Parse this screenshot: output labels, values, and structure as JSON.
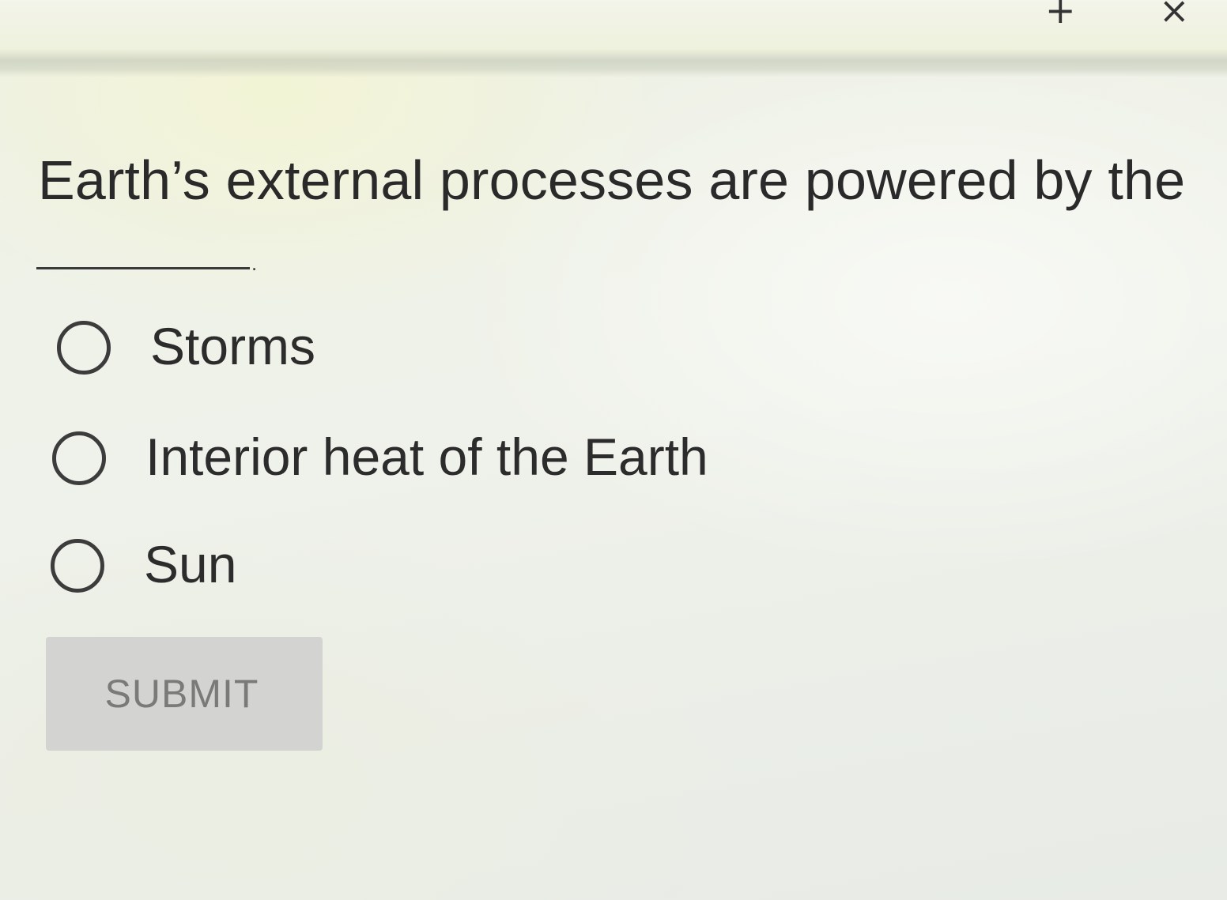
{
  "window_controls": {
    "add_symbol": "+",
    "close_symbol": "×"
  },
  "question": {
    "text": "Earth’s external processes are powered by the",
    "blank_end": "."
  },
  "options": [
    {
      "label": "Storms",
      "selected": false
    },
    {
      "label": "Interior heat of the Earth",
      "selected": false
    },
    {
      "label": "Sun",
      "selected": false
    }
  ],
  "submit": {
    "label": "SUBMIT",
    "enabled": false
  },
  "colors": {
    "text": "#2a2a2a",
    "submit_bg": "#d3d3d1",
    "submit_text": "#7a7a78"
  }
}
